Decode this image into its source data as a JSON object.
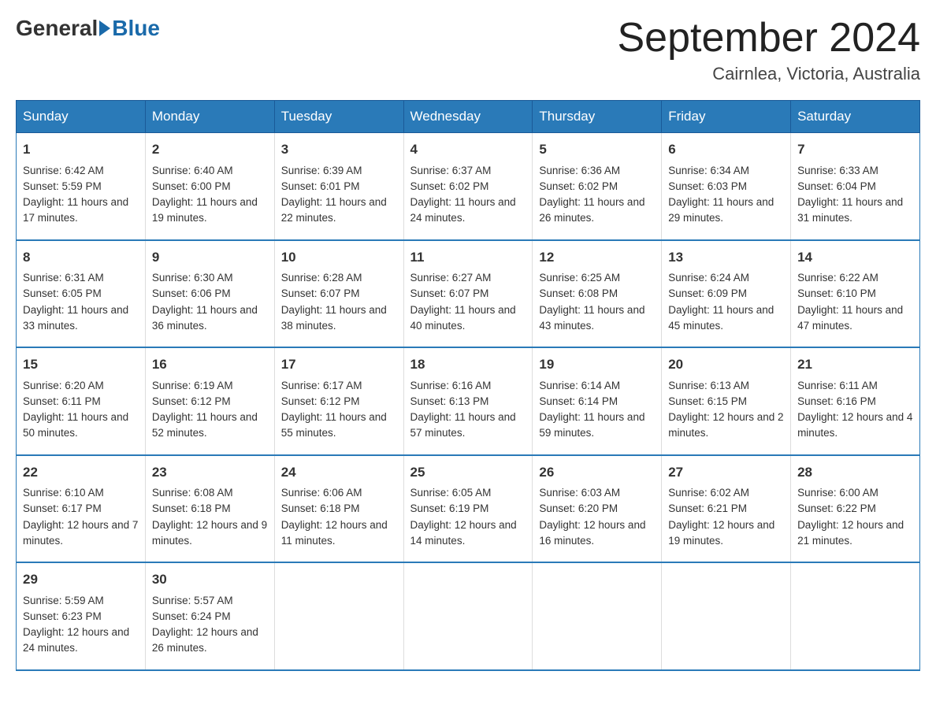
{
  "logo": {
    "general": "General",
    "blue": "Blue"
  },
  "title": "September 2024",
  "location": "Cairnlea, Victoria, Australia",
  "days_of_week": [
    "Sunday",
    "Monday",
    "Tuesday",
    "Wednesday",
    "Thursday",
    "Friday",
    "Saturday"
  ],
  "weeks": [
    [
      {
        "day": "1",
        "sunrise": "6:42 AM",
        "sunset": "5:59 PM",
        "daylight": "11 hours and 17 minutes."
      },
      {
        "day": "2",
        "sunrise": "6:40 AM",
        "sunset": "6:00 PM",
        "daylight": "11 hours and 19 minutes."
      },
      {
        "day": "3",
        "sunrise": "6:39 AM",
        "sunset": "6:01 PM",
        "daylight": "11 hours and 22 minutes."
      },
      {
        "day": "4",
        "sunrise": "6:37 AM",
        "sunset": "6:02 PM",
        "daylight": "11 hours and 24 minutes."
      },
      {
        "day": "5",
        "sunrise": "6:36 AM",
        "sunset": "6:02 PM",
        "daylight": "11 hours and 26 minutes."
      },
      {
        "day": "6",
        "sunrise": "6:34 AM",
        "sunset": "6:03 PM",
        "daylight": "11 hours and 29 minutes."
      },
      {
        "day": "7",
        "sunrise": "6:33 AM",
        "sunset": "6:04 PM",
        "daylight": "11 hours and 31 minutes."
      }
    ],
    [
      {
        "day": "8",
        "sunrise": "6:31 AM",
        "sunset": "6:05 PM",
        "daylight": "11 hours and 33 minutes."
      },
      {
        "day": "9",
        "sunrise": "6:30 AM",
        "sunset": "6:06 PM",
        "daylight": "11 hours and 36 minutes."
      },
      {
        "day": "10",
        "sunrise": "6:28 AM",
        "sunset": "6:07 PM",
        "daylight": "11 hours and 38 minutes."
      },
      {
        "day": "11",
        "sunrise": "6:27 AM",
        "sunset": "6:07 PM",
        "daylight": "11 hours and 40 minutes."
      },
      {
        "day": "12",
        "sunrise": "6:25 AM",
        "sunset": "6:08 PM",
        "daylight": "11 hours and 43 minutes."
      },
      {
        "day": "13",
        "sunrise": "6:24 AM",
        "sunset": "6:09 PM",
        "daylight": "11 hours and 45 minutes."
      },
      {
        "day": "14",
        "sunrise": "6:22 AM",
        "sunset": "6:10 PM",
        "daylight": "11 hours and 47 minutes."
      }
    ],
    [
      {
        "day": "15",
        "sunrise": "6:20 AM",
        "sunset": "6:11 PM",
        "daylight": "11 hours and 50 minutes."
      },
      {
        "day": "16",
        "sunrise": "6:19 AM",
        "sunset": "6:12 PM",
        "daylight": "11 hours and 52 minutes."
      },
      {
        "day": "17",
        "sunrise": "6:17 AM",
        "sunset": "6:12 PM",
        "daylight": "11 hours and 55 minutes."
      },
      {
        "day": "18",
        "sunrise": "6:16 AM",
        "sunset": "6:13 PM",
        "daylight": "11 hours and 57 minutes."
      },
      {
        "day": "19",
        "sunrise": "6:14 AM",
        "sunset": "6:14 PM",
        "daylight": "11 hours and 59 minutes."
      },
      {
        "day": "20",
        "sunrise": "6:13 AM",
        "sunset": "6:15 PM",
        "daylight": "12 hours and 2 minutes."
      },
      {
        "day": "21",
        "sunrise": "6:11 AM",
        "sunset": "6:16 PM",
        "daylight": "12 hours and 4 minutes."
      }
    ],
    [
      {
        "day": "22",
        "sunrise": "6:10 AM",
        "sunset": "6:17 PM",
        "daylight": "12 hours and 7 minutes."
      },
      {
        "day": "23",
        "sunrise": "6:08 AM",
        "sunset": "6:18 PM",
        "daylight": "12 hours and 9 minutes."
      },
      {
        "day": "24",
        "sunrise": "6:06 AM",
        "sunset": "6:18 PM",
        "daylight": "12 hours and 11 minutes."
      },
      {
        "day": "25",
        "sunrise": "6:05 AM",
        "sunset": "6:19 PM",
        "daylight": "12 hours and 14 minutes."
      },
      {
        "day": "26",
        "sunrise": "6:03 AM",
        "sunset": "6:20 PM",
        "daylight": "12 hours and 16 minutes."
      },
      {
        "day": "27",
        "sunrise": "6:02 AM",
        "sunset": "6:21 PM",
        "daylight": "12 hours and 19 minutes."
      },
      {
        "day": "28",
        "sunrise": "6:00 AM",
        "sunset": "6:22 PM",
        "daylight": "12 hours and 21 minutes."
      }
    ],
    [
      {
        "day": "29",
        "sunrise": "5:59 AM",
        "sunset": "6:23 PM",
        "daylight": "12 hours and 24 minutes."
      },
      {
        "day": "30",
        "sunrise": "5:57 AM",
        "sunset": "6:24 PM",
        "daylight": "12 hours and 26 minutes."
      },
      null,
      null,
      null,
      null,
      null
    ]
  ],
  "labels": {
    "sunrise": "Sunrise:",
    "sunset": "Sunset:",
    "daylight": "Daylight:"
  }
}
